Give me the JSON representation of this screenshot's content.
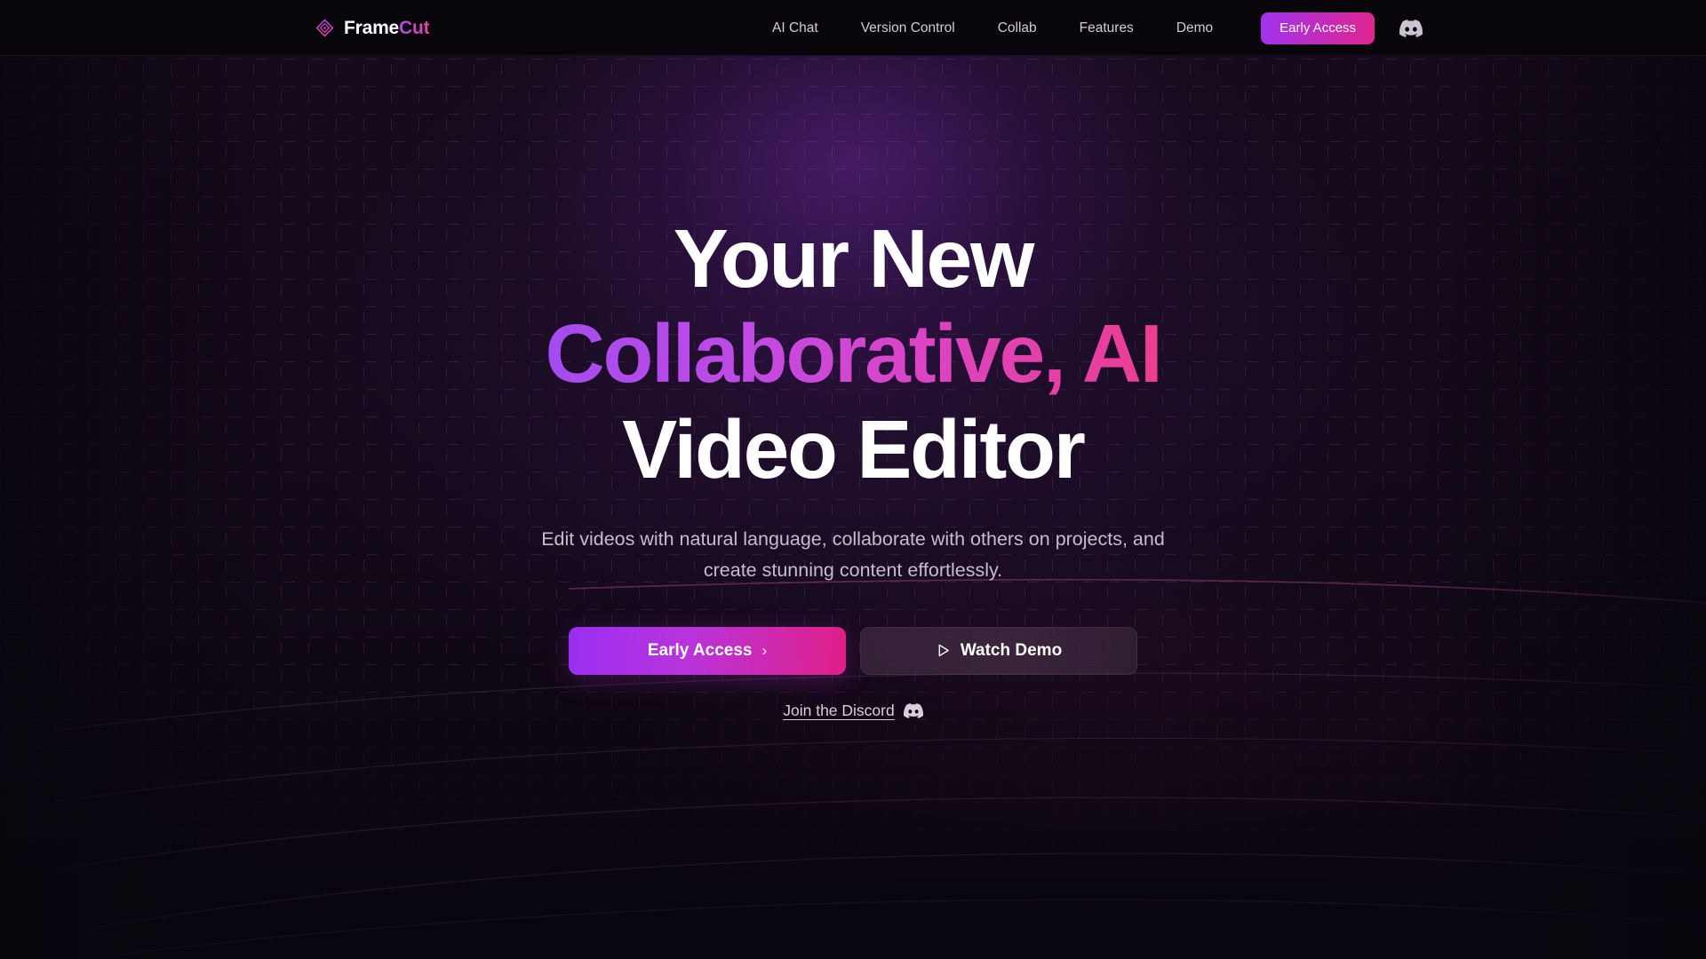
{
  "brand": {
    "name_part1": "Frame",
    "name_part2": "Cut",
    "logo_icon": "diamond-logo-icon",
    "accent_purple": "#a855f7",
    "accent_pink": "#ec4899"
  },
  "header": {
    "nav_links": [
      {
        "label": "AI Chat",
        "name": "ai-chat"
      },
      {
        "label": "Version Control",
        "name": "version-control"
      },
      {
        "label": "Collab",
        "name": "collab"
      },
      {
        "label": "Features",
        "name": "features"
      },
      {
        "label": "Demo",
        "name": "demo"
      }
    ],
    "cta_label": "Early Access",
    "discord_icon": "discord-icon"
  },
  "hero": {
    "headline_line1": "Your New",
    "headline_line2": "Collaborative, AI",
    "headline_line3": "Video Editor",
    "subheadline_line1": "Edit videos with natural language, collaborate with others on",
    "subheadline_line2": "projects, and create stunning content effortlessly.",
    "primary_cta": "Early Access",
    "primary_cta_icon": "chevron-right-icon",
    "secondary_cta": "Watch Demo",
    "secondary_cta_icon": "play-icon",
    "discord_link": "Join the Discord",
    "discord_link_icon": "discord-icon"
  }
}
